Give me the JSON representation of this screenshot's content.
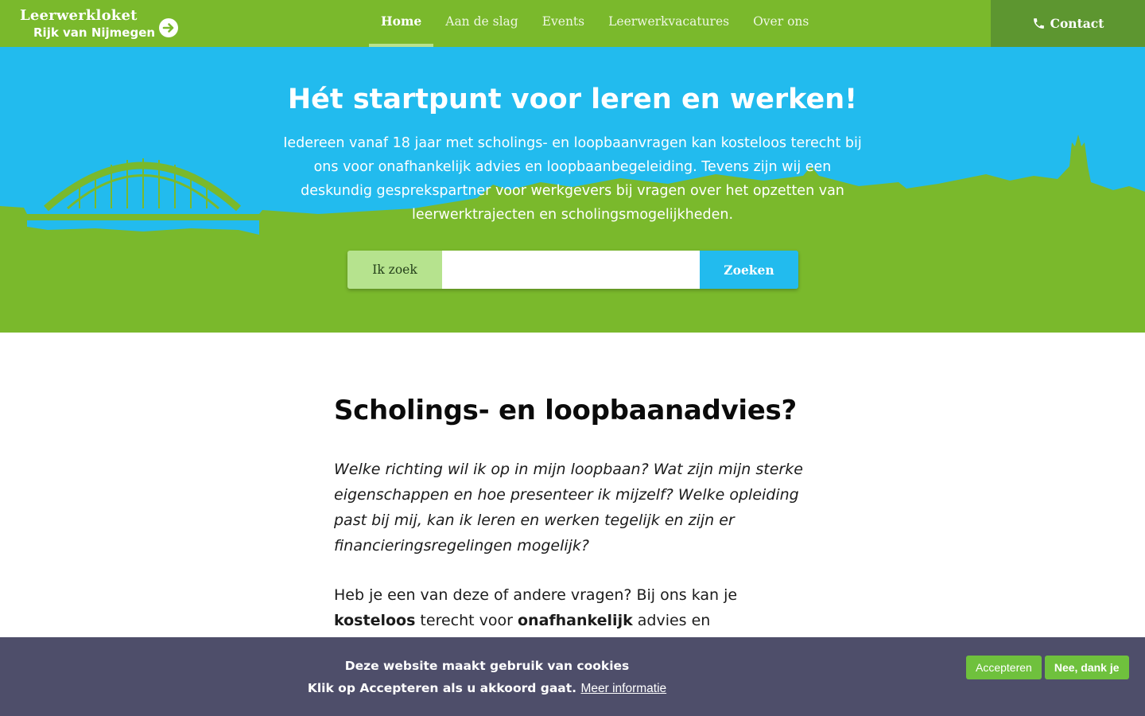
{
  "header": {
    "logo_line1": "Leerwerkloket",
    "logo_line2": "Rijk van Nijmegen",
    "logo_icon": "arrow-right-circle-icon",
    "nav": [
      {
        "label": "Home",
        "active": true
      },
      {
        "label": "Aan de slag",
        "active": false
      },
      {
        "label": "Events",
        "active": false
      },
      {
        "label": "Leerwerkvacatures",
        "active": false
      },
      {
        "label": "Over ons",
        "active": false
      }
    ],
    "contact_label": "Contact",
    "contact_icon": "phone-icon"
  },
  "hero": {
    "title": "Hét startpunt voor leren en werken!",
    "text": "Iedereen vanaf 18 jaar met scholings- en loopbaanvragen kan kosteloos terecht bij ons voor onafhankelijk advies en loopbaanbegeleiding. Tevens zijn wij een deskundig gesprekspartner voor werkgevers bij vragen over het opzetten van leerwerktrajecten en scholingsmogelijkheden.",
    "search_label": "Ik zoek",
    "search_value": "",
    "search_button": "Zoeken"
  },
  "content": {
    "heading": "Scholings- en loopbaanadvies?",
    "intro": "Welke richting wil ik op in mijn loopbaan? Wat zijn mijn sterke eigenschappen en hoe presenteer ik mijzelf? Welke opleiding past bij mij, kan ik leren en werken tegelijk en zijn er financieringsregelingen mogelijk?",
    "para_part1": "Heb je een van deze of andere vragen? Bij ons kan je ",
    "para_bold1": "kosteloos",
    "para_part2": " terecht voor ",
    "para_bold2": "onafhankelijk",
    "para_part3": " advies en"
  },
  "cookie": {
    "line1": "Deze website maakt gebruik van cookies",
    "line2": "Klik op Accepteren als u akkoord gaat.",
    "more_info": "Meer informatie",
    "accept": "Accepteren",
    "decline": "Nee, dank je"
  },
  "colors": {
    "brand_green": "#7ab92c",
    "dark_green": "#5d9630",
    "sky_blue": "#22bbee",
    "cookie_bg": "#4e4e6a"
  }
}
